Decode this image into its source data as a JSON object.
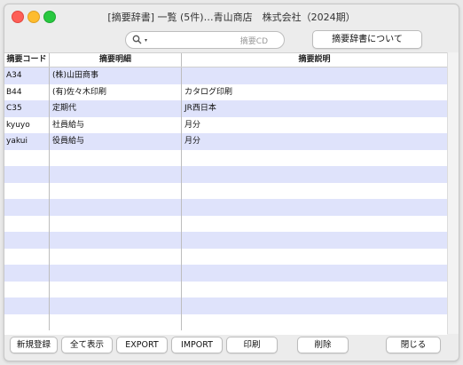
{
  "window": {
    "title": "[摘要辞書] 一覧 (5件)…青山商店　株式会社（2024期）"
  },
  "search": {
    "placeholder": "摘要CD",
    "caret": "▾"
  },
  "about_button": "摘要辞書について",
  "table": {
    "headers": [
      "摘要コード",
      "摘要明細",
      "摘要説明"
    ],
    "rows": [
      [
        "A34",
        "(株)山田商事",
        ""
      ],
      [
        "B44",
        "(有)佐々木印刷",
        "カタログ印刷"
      ],
      [
        "C35",
        "定期代",
        "JR西日本"
      ],
      [
        "kyuyo",
        "社員給与",
        "月分"
      ],
      [
        "yakui",
        "役員給与",
        "月分"
      ],
      [
        "",
        "",
        ""
      ],
      [
        "",
        "",
        ""
      ],
      [
        "",
        "",
        ""
      ],
      [
        "",
        "",
        ""
      ],
      [
        "",
        "",
        ""
      ],
      [
        "",
        "",
        ""
      ],
      [
        "",
        "",
        ""
      ],
      [
        "",
        "",
        ""
      ],
      [
        "",
        "",
        ""
      ],
      [
        "",
        "",
        ""
      ],
      [
        "",
        "",
        ""
      ]
    ]
  },
  "buttons": {
    "new": "新規登録",
    "show_all": "全て表示",
    "export": "EXPORT",
    "import": "IMPORT",
    "print": "印刷",
    "delete": "削除",
    "close": "閉じる"
  }
}
